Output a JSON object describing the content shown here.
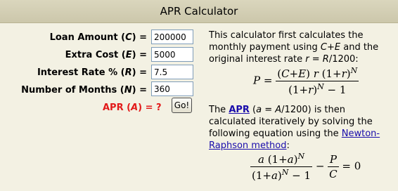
{
  "header": {
    "title": "APR Calculator"
  },
  "form": {
    "loan_amount": {
      "label": "Loan Amount",
      "var": "C",
      "value": "200000"
    },
    "extra_cost": {
      "label": "Extra Cost",
      "var": "E",
      "value": "5000"
    },
    "interest_rate": {
      "label": "Interest Rate %",
      "var": "R",
      "value": "7.5"
    },
    "months": {
      "label": "Number of Months",
      "var": "N",
      "value": "360"
    },
    "apr": {
      "label": "APR",
      "var": "A",
      "result": "?"
    },
    "go_label": "Go!"
  },
  "description": {
    "p1_a": "This calculator first calculates the monthly payment using ",
    "p1_ce": "C+E",
    "p1_b": " and the original interest rate ",
    "p1_r": "r = R",
    "p1_c": "/1200:",
    "p2_a": "The ",
    "apr_link": "APR",
    "p2_b": " (",
    "p2_a_var": "a = A",
    "p2_c": "/1200) is then calculated iteratively by solving the following equation using the ",
    "newton_link": "Newton-Raphson method",
    "p2_d": ":"
  }
}
